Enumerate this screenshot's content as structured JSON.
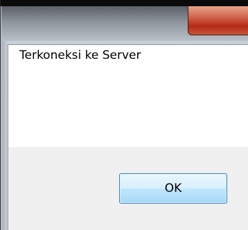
{
  "dialog": {
    "message": "Terkoneksi ke Server",
    "ok_label": "OK"
  },
  "colors": {
    "close_button": "#c8462f",
    "ok_button_border": "#3c7fb1",
    "footer_bg": "#f0f0f0"
  },
  "icons": {
    "close": "close-icon"
  }
}
